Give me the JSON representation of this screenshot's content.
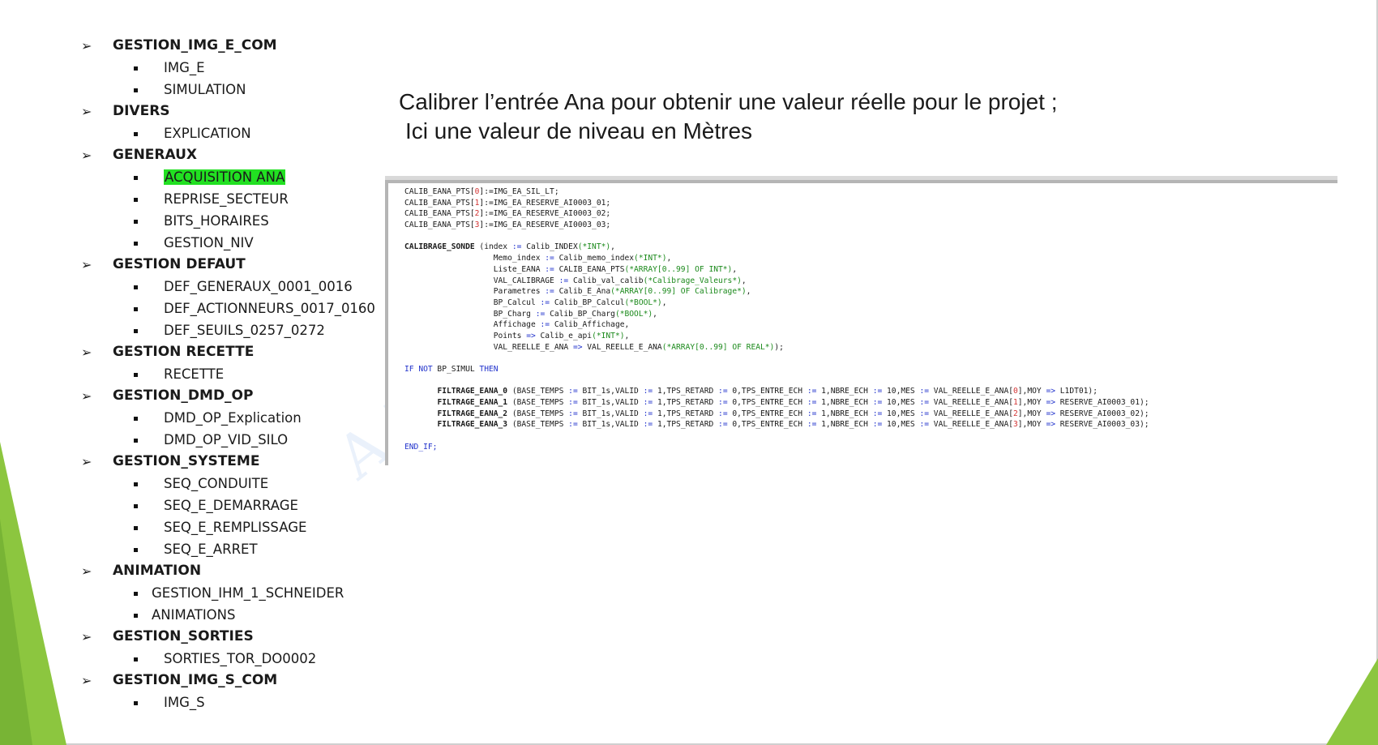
{
  "outline": [
    {
      "title": "GESTION_IMG_E_COM",
      "items": [
        {
          "label": "IMG_E"
        },
        {
          "label": "SIMULATION"
        }
      ]
    },
    {
      "title": "DIVERS",
      "items": [
        {
          "label": "EXPLICATION"
        }
      ]
    },
    {
      "title": "GENERAUX",
      "items": [
        {
          "label": "ACQUISITION ANA",
          "highlighted": true
        },
        {
          "label": "REPRISE_SECTEUR"
        },
        {
          "label": "BITS_HORAIRES"
        },
        {
          "label": "GESTION_NIV"
        }
      ]
    },
    {
      "title": "GESTION DEFAUT",
      "items": [
        {
          "label": "DEF_GENERAUX_0001_0016"
        },
        {
          "label": "DEF_ACTIONNEURS_0017_0160"
        },
        {
          "label": "DEF_SEUILS_0257_0272"
        }
      ]
    },
    {
      "title": "GESTION RECETTE",
      "items": [
        {
          "label": "RECETTE"
        }
      ]
    },
    {
      "title": "GESTION_DMD_OP",
      "items": [
        {
          "label": "DMD_OP_Explication"
        },
        {
          "label": "DMD_OP_VID_SILO"
        }
      ]
    },
    {
      "title": "GESTION_SYSTEME",
      "items": [
        {
          "label": "SEQ_CONDUITE"
        },
        {
          "label": "SEQ_E_DEMARRAGE"
        },
        {
          "label": "SEQ_E_REMPLISSAGE"
        },
        {
          "label": "SEQ_E_ARRET"
        }
      ]
    },
    {
      "title": "ANIMATION",
      "items": [
        {
          "label": "GESTION_IHM_1_SCHNEIDER",
          "short": true
        },
        {
          "label": "ANIMATIONS",
          "short": true
        }
      ]
    },
    {
      "title": "GESTION_SORTIES",
      "items": [
        {
          "label": "SORTIES_TOR_DO0002"
        }
      ]
    },
    {
      "title": "GESTION_IMG_S_COM",
      "items": [
        {
          "label": "IMG_S"
        }
      ]
    }
  ],
  "heading": {
    "line1": "Calibrer l’entrée Ana pour obtenir une valeur réelle pour le projet ;",
    "line2": "Ici une valeur de niveau en Mètres"
  },
  "watermark": "AEI F",
  "colors": {
    "highlight": "#22e022",
    "keyword": "#2233cc",
    "comment": "#1c8a1c",
    "number": "#d33333",
    "accent_green": "#8cc63f"
  },
  "code_lines": [
    [
      {
        "t": "CALIB_EANA_PTS["
      },
      {
        "t": "0",
        "c": "num"
      },
      {
        "t": "]:=IMG_EA_SIL_LT;"
      }
    ],
    [
      {
        "t": "CALIB_EANA_PTS["
      },
      {
        "t": "1",
        "c": "num"
      },
      {
        "t": "]:=IMG_EA_RESERVE_AI0003_01;"
      }
    ],
    [
      {
        "t": "CALIB_EANA_PTS["
      },
      {
        "t": "2",
        "c": "num"
      },
      {
        "t": "]:=IMG_EA_RESERVE_AI0003_02;"
      }
    ],
    [
      {
        "t": "CALIB_EANA_PTS["
      },
      {
        "t": "3",
        "c": "num"
      },
      {
        "t": "]:=IMG_EA_RESERVE_AI0003_03;"
      }
    ],
    [],
    [
      {
        "t": "CALIBRAGE_SONDE",
        "c": "bd"
      },
      {
        "t": " (index "
      },
      {
        "t": ":=",
        "c": "kw"
      },
      {
        "t": " Calib_INDEX"
      },
      {
        "t": "(*INT*)",
        "c": "cm"
      },
      {
        "t": ","
      }
    ],
    [
      {
        "t": "                   Memo_index "
      },
      {
        "t": ":=",
        "c": "kw"
      },
      {
        "t": " Calib_memo_index"
      },
      {
        "t": "(*INT*)",
        "c": "cm"
      },
      {
        "t": ","
      }
    ],
    [
      {
        "t": "                   Liste_EANA "
      },
      {
        "t": ":=",
        "c": "kw"
      },
      {
        "t": " CALIB_EANA_PTS"
      },
      {
        "t": "(*ARRAY[0..99] OF INT*)",
        "c": "cm"
      },
      {
        "t": ","
      }
    ],
    [
      {
        "t": "                   VAL_CALIBRAGE "
      },
      {
        "t": ":=",
        "c": "kw"
      },
      {
        "t": " Calib_val_calib"
      },
      {
        "t": "(*Calibrage_Valeurs*)",
        "c": "cm"
      },
      {
        "t": ","
      }
    ],
    [
      {
        "t": "                   Parametres "
      },
      {
        "t": ":=",
        "c": "kw"
      },
      {
        "t": " Calib_E_Ana"
      },
      {
        "t": "(*ARRAY[0..99] OF Calibrage*)",
        "c": "cm"
      },
      {
        "t": ","
      }
    ],
    [
      {
        "t": "                   BP_Calcul "
      },
      {
        "t": ":=",
        "c": "kw"
      },
      {
        "t": " Calib_BP_Calcul"
      },
      {
        "t": "(*BOOL*)",
        "c": "cm"
      },
      {
        "t": ","
      }
    ],
    [
      {
        "t": "                   BP_Charg "
      },
      {
        "t": ":=",
        "c": "kw"
      },
      {
        "t": " Calib_BP_Charg"
      },
      {
        "t": "(*BOOL*)",
        "c": "cm"
      },
      {
        "t": ","
      }
    ],
    [
      {
        "t": "                   Affichage "
      },
      {
        "t": ":=",
        "c": "kw"
      },
      {
        "t": " Calib_Affichage,"
      }
    ],
    [
      {
        "t": "                   Points "
      },
      {
        "t": "=>",
        "c": "kw"
      },
      {
        "t": " Calib_e_api"
      },
      {
        "t": "(*INT*)",
        "c": "cm"
      },
      {
        "t": ","
      }
    ],
    [
      {
        "t": "                   VAL_REELLE_E_ANA "
      },
      {
        "t": "=>",
        "c": "kw"
      },
      {
        "t": " VAL_REELLE_E_ANA"
      },
      {
        "t": "(*ARRAY[0..99] OF REAL*)",
        "c": "cm"
      },
      {
        "t": ");"
      }
    ],
    [],
    [
      {
        "t": "IF NOT",
        "c": "kw"
      },
      {
        "t": " BP_SIMUL "
      },
      {
        "t": "THEN",
        "c": "kw"
      }
    ],
    [],
    [
      {
        "t": "       "
      },
      {
        "t": "FILTRAGE_EANA_0",
        "c": "bd"
      },
      {
        "t": " (BASE_TEMPS "
      },
      {
        "t": ":=",
        "c": "kw"
      },
      {
        "t": " BIT_1s,VALID "
      },
      {
        "t": ":=",
        "c": "kw"
      },
      {
        "t": " 1,TPS_RETARD "
      },
      {
        "t": ":=",
        "c": "kw"
      },
      {
        "t": " 0,TPS_ENTRE_ECH "
      },
      {
        "t": ":=",
        "c": "kw"
      },
      {
        "t": " 1,NBRE_ECH "
      },
      {
        "t": ":=",
        "c": "kw"
      },
      {
        "t": " 10,MES "
      },
      {
        "t": ":=",
        "c": "kw"
      },
      {
        "t": " VAL_REELLE_E_ANA["
      },
      {
        "t": "0",
        "c": "num"
      },
      {
        "t": "],MOY "
      },
      {
        "t": "=>",
        "c": "kw"
      },
      {
        "t": " L1DT01);"
      }
    ],
    [
      {
        "t": "       "
      },
      {
        "t": "FILTRAGE_EANA_1",
        "c": "bd"
      },
      {
        "t": " (BASE_TEMPS "
      },
      {
        "t": ":=",
        "c": "kw"
      },
      {
        "t": " BIT_1s,VALID "
      },
      {
        "t": ":=",
        "c": "kw"
      },
      {
        "t": " 1,TPS_RETARD "
      },
      {
        "t": ":=",
        "c": "kw"
      },
      {
        "t": " 0,TPS_ENTRE_ECH "
      },
      {
        "t": ":=",
        "c": "kw"
      },
      {
        "t": " 1,NBRE_ECH "
      },
      {
        "t": ":=",
        "c": "kw"
      },
      {
        "t": " 10,MES "
      },
      {
        "t": ":=",
        "c": "kw"
      },
      {
        "t": " VAL_REELLE_E_ANA["
      },
      {
        "t": "1",
        "c": "num"
      },
      {
        "t": "],MOY "
      },
      {
        "t": "=>",
        "c": "kw"
      },
      {
        "t": " RESERVE_AI0003_01);"
      }
    ],
    [
      {
        "t": "       "
      },
      {
        "t": "FILTRAGE_EANA_2",
        "c": "bd"
      },
      {
        "t": " (BASE_TEMPS "
      },
      {
        "t": ":=",
        "c": "kw"
      },
      {
        "t": " BIT_1s,VALID "
      },
      {
        "t": ":=",
        "c": "kw"
      },
      {
        "t": " 1,TPS_RETARD "
      },
      {
        "t": ":=",
        "c": "kw"
      },
      {
        "t": " 0,TPS_ENTRE_ECH "
      },
      {
        "t": ":=",
        "c": "kw"
      },
      {
        "t": " 1,NBRE_ECH "
      },
      {
        "t": ":=",
        "c": "kw"
      },
      {
        "t": " 10,MES "
      },
      {
        "t": ":=",
        "c": "kw"
      },
      {
        "t": " VAL_REELLE_E_ANA["
      },
      {
        "t": "2",
        "c": "num"
      },
      {
        "t": "],MOY "
      },
      {
        "t": "=>",
        "c": "kw"
      },
      {
        "t": " RESERVE_AI0003_02);"
      }
    ],
    [
      {
        "t": "       "
      },
      {
        "t": "FILTRAGE_EANA_3",
        "c": "bd"
      },
      {
        "t": " (BASE_TEMPS "
      },
      {
        "t": ":=",
        "c": "kw"
      },
      {
        "t": " BIT_1s,VALID "
      },
      {
        "t": ":=",
        "c": "kw"
      },
      {
        "t": " 1,TPS_RETARD "
      },
      {
        "t": ":=",
        "c": "kw"
      },
      {
        "t": " 0,TPS_ENTRE_ECH "
      },
      {
        "t": ":=",
        "c": "kw"
      },
      {
        "t": " 1,NBRE_ECH "
      },
      {
        "t": ":=",
        "c": "kw"
      },
      {
        "t": " 10,MES "
      },
      {
        "t": ":=",
        "c": "kw"
      },
      {
        "t": " VAL_REELLE_E_ANA["
      },
      {
        "t": "3",
        "c": "num"
      },
      {
        "t": "],MOY "
      },
      {
        "t": "=>",
        "c": "kw"
      },
      {
        "t": " RESERVE_AI0003_03);"
      }
    ],
    [],
    [
      {
        "t": "END_IF;",
        "c": "kw"
      }
    ]
  ]
}
